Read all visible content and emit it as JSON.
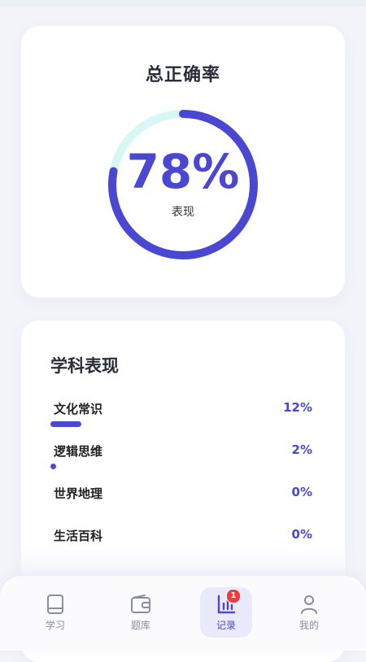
{
  "accuracy": {
    "title": "总正确率",
    "percent_label": "78%",
    "percent_value": 78,
    "subtitle": "表现"
  },
  "subjects": {
    "title": "学科表现",
    "items": [
      {
        "name": "文化常识",
        "value_label": "12%",
        "value": 12
      },
      {
        "name": "逻辑思维",
        "value_label": "2%",
        "value": 2
      },
      {
        "name": "世界地理",
        "value_label": "0%",
        "value": 0
      },
      {
        "name": "生活百科",
        "value_label": "0%",
        "value": 0
      }
    ]
  },
  "tabbar": {
    "items": [
      {
        "label": "学习",
        "icon": "book-icon"
      },
      {
        "label": "题库",
        "icon": "wallet-icon"
      },
      {
        "label": "记录",
        "icon": "bar-chart-icon",
        "active": true,
        "badge": "1"
      },
      {
        "label": "我的",
        "icon": "user-icon"
      }
    ]
  },
  "colors": {
    "accent": "#4a48d3",
    "ring_track": "#d6f7f4",
    "badge": "#ef3d3d"
  }
}
